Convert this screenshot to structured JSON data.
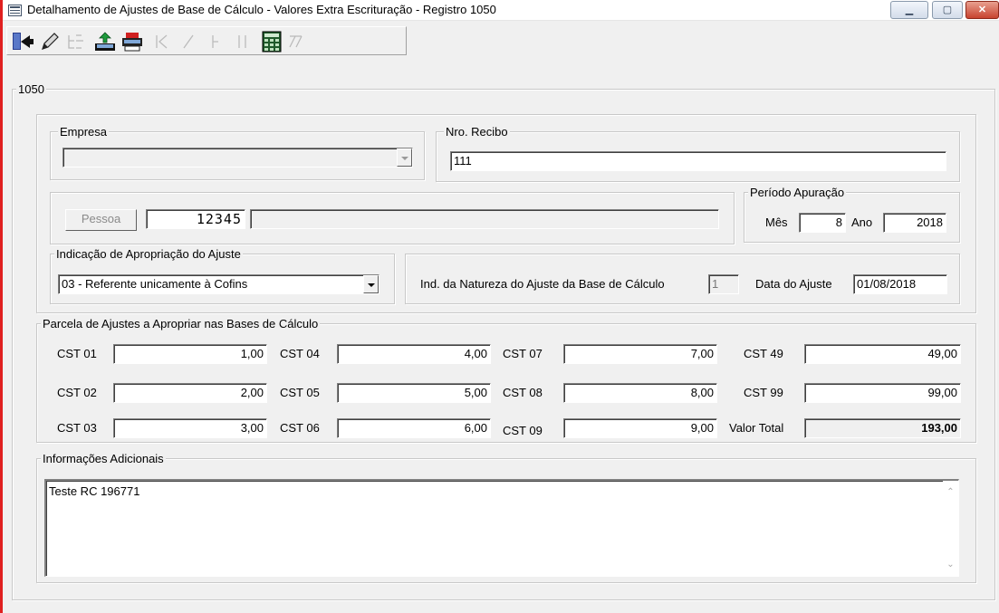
{
  "window": {
    "title": "Detalhamento de Ajustes de Base de Cálculo - Valores Extra Escrituração - Registro 1050",
    "controls": {
      "minimize": "▁",
      "maximize": "▢",
      "close": "✕"
    }
  },
  "toolbar": {
    "buttons": [
      {
        "name": "exit",
        "icon": "exit-door-icon",
        "enabled": true
      },
      {
        "name": "edit",
        "icon": "pencil-icon",
        "enabled": true
      },
      {
        "name": "dependents",
        "icon": "tree-icon",
        "enabled": false
      },
      {
        "name": "import",
        "icon": "import-tray-icon",
        "enabled": true
      },
      {
        "name": "print",
        "icon": "printer-icon",
        "enabled": true
      },
      {
        "name": "first",
        "icon": "first-record-icon",
        "enabled": false
      },
      {
        "name": "confirm",
        "icon": "check-icon",
        "enabled": false
      },
      {
        "name": "next",
        "icon": "next-record-icon",
        "enabled": false
      },
      {
        "name": "last",
        "icon": "last-record-icon",
        "enabled": false
      },
      {
        "name": "calculator",
        "icon": "calculator-icon",
        "enabled": true
      },
      {
        "name": "validate",
        "icon": "double-check-icon",
        "enabled": false
      }
    ]
  },
  "register_group": {
    "legend": "1050"
  },
  "empresa": {
    "legend": "Empresa",
    "value": ""
  },
  "recibo": {
    "legend": "Nro. Recibo",
    "value": "111"
  },
  "pessoa": {
    "button": "Pessoa",
    "code": "12345",
    "name": ""
  },
  "periodo": {
    "legend": "Período Apuração",
    "mes_label": "Mês",
    "mes": "8",
    "ano_label": "Ano",
    "ano": "2018"
  },
  "indicacao": {
    "legend": "Indicação de Apropriação do Ajuste",
    "selected": "03 - Referente unicamente à Cofins"
  },
  "natureza": {
    "label": "Ind. da Natureza do Ajuste da Base de Cálculo",
    "value": "1",
    "data_label": "Data do Ajuste",
    "data_value": "01/08/2018"
  },
  "parcela": {
    "legend": "Parcela de Ajustes a Apropriar nas Bases de Cálculo",
    "cst01": {
      "label": "CST 01",
      "value": "1,00"
    },
    "cst02": {
      "label": "CST 02",
      "value": "2,00"
    },
    "cst03": {
      "label": "CST 03",
      "value": "3,00"
    },
    "cst04": {
      "label": "CST 04",
      "value": "4,00"
    },
    "cst05": {
      "label": "CST 05",
      "value": "5,00"
    },
    "cst06": {
      "label": "CST 06",
      "value": "6,00"
    },
    "cst07": {
      "label": "CST 07",
      "value": "7,00"
    },
    "cst08": {
      "label": "CST 08",
      "value": "8,00"
    },
    "cst09": {
      "label": "CST 09",
      "value": "9,00"
    },
    "cst49": {
      "label": "CST 49",
      "value": "49,00"
    },
    "cst99": {
      "label": "CST 99",
      "value": "99,00"
    },
    "total": {
      "label": "Valor Total",
      "value": "193,00"
    }
  },
  "informacoes": {
    "legend": "Informações Adicionais",
    "text": "Teste RC 196771",
    "scroll_up": "⌃",
    "scroll_down": "⌄"
  },
  "colors": {
    "accent_border": "#e02020",
    "window_bg": "#f0f0f0"
  }
}
